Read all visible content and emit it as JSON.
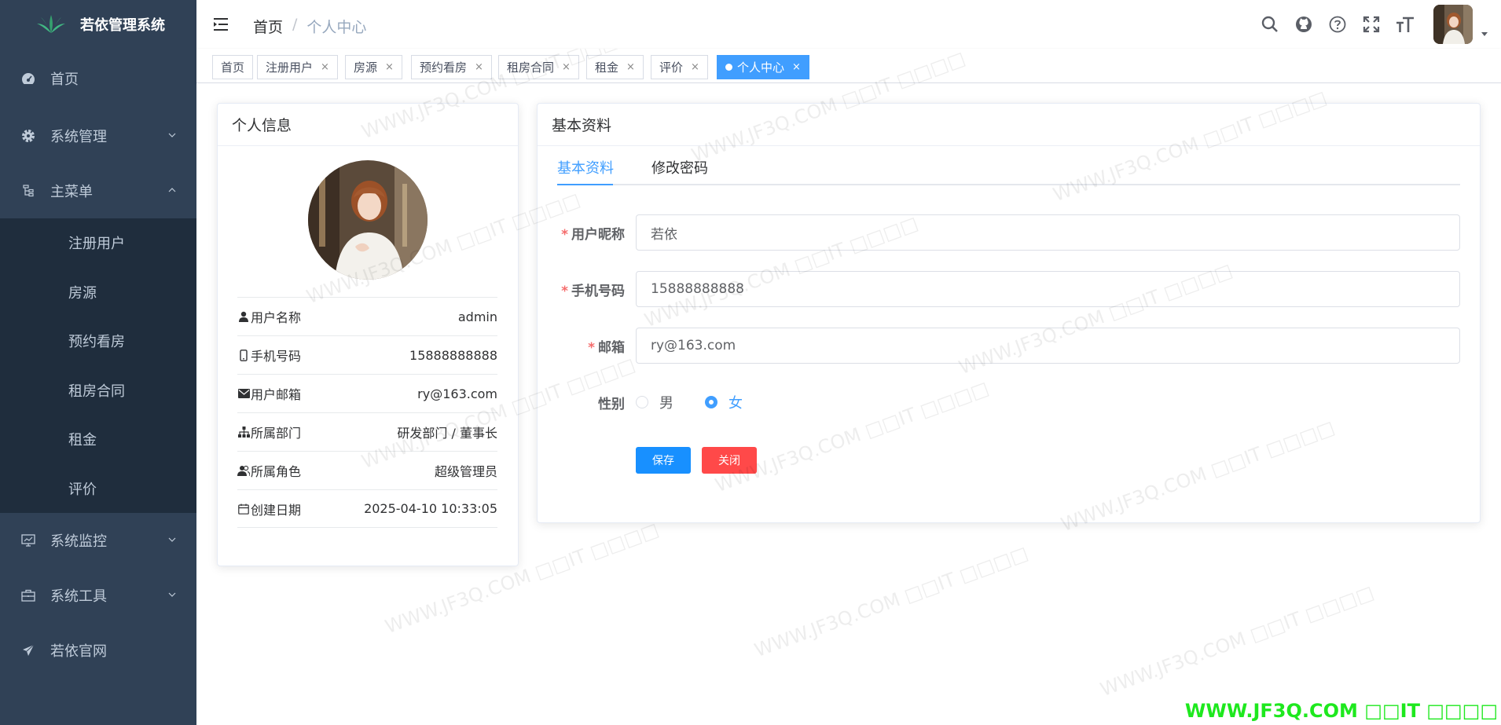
{
  "app": {
    "title": "若依管理系统"
  },
  "sidebar": {
    "items": [
      {
        "label": "首页",
        "icon": "dashboard-icon"
      },
      {
        "label": "系统管理",
        "icon": "gear-icon"
      },
      {
        "label": "主菜单",
        "icon": "tree-icon"
      }
    ],
    "submenu": [
      "注册用户",
      "房源",
      "预约看房",
      "租房合同",
      "租金",
      "评价"
    ],
    "bottom_items": [
      {
        "label": "系统监控",
        "icon": "monitor-icon"
      },
      {
        "label": "系统工具",
        "icon": "toolbox-icon"
      },
      {
        "label": "若依官网",
        "icon": "send-icon"
      }
    ]
  },
  "breadcrumb": {
    "home": "首页",
    "separator": "/",
    "current": "个人中心"
  },
  "tags": [
    {
      "label": "首页",
      "closable": false
    },
    {
      "label": "注册用户",
      "closable": true
    },
    {
      "label": "房源",
      "closable": true
    },
    {
      "label": "预约看房",
      "closable": true
    },
    {
      "label": "租房合同",
      "closable": true
    },
    {
      "label": "租金",
      "closable": true
    },
    {
      "label": "评价",
      "closable": true
    },
    {
      "label": "个人中心",
      "closable": true,
      "active": true
    }
  ],
  "profile_card": {
    "title": "个人信息",
    "rows": [
      {
        "label": "用户名称",
        "value": "admin",
        "icon": "user-icon"
      },
      {
        "label": "手机号码",
        "value": "15888888888",
        "icon": "phone-icon"
      },
      {
        "label": "用户邮箱",
        "value": "ry@163.com",
        "icon": "mail-icon"
      },
      {
        "label": "所属部门",
        "value": "研发部门 / 董事长",
        "icon": "org-icon"
      },
      {
        "label": "所属角色",
        "value": "超级管理员",
        "icon": "role-icon"
      },
      {
        "label": "创建日期",
        "value": "2025-04-10 10:33:05",
        "icon": "calendar-icon"
      }
    ]
  },
  "form_card": {
    "title": "基本资料",
    "tabs": [
      "基本资料",
      "修改密码"
    ],
    "fields": {
      "nickname": {
        "label": "用户昵称",
        "value": "若依"
      },
      "phone": {
        "label": "手机号码",
        "value": "15888888888"
      },
      "email": {
        "label": "邮箱",
        "value": "ry@163.com"
      },
      "gender": {
        "label": "性别",
        "options": [
          "男",
          "女"
        ],
        "selected": "女"
      }
    },
    "save_label": "保存",
    "close_label": "关闭"
  },
  "watermark": {
    "text": "WWW.JF3Q.COM □□IT □□□□"
  },
  "colors": {
    "sidebar": "#304156",
    "submenu": "#1f2d3d",
    "accent": "#409eff",
    "danger": "#ff4949",
    "watermark_corner": "#1ee81e"
  }
}
